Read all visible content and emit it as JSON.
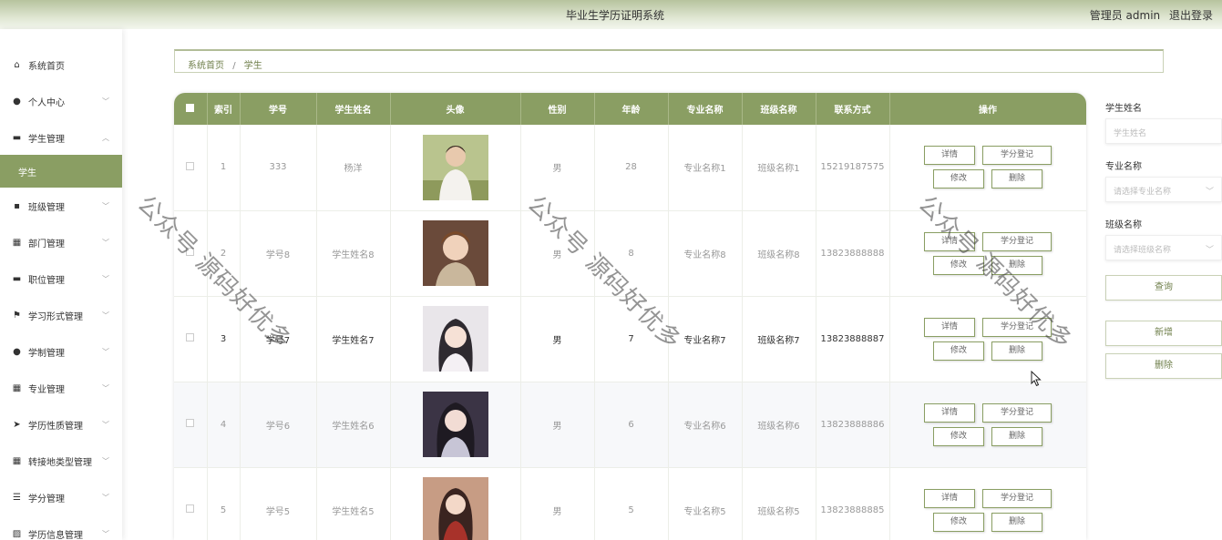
{
  "header": {
    "title": "毕业生学历证明系统",
    "user": "管理员 admin",
    "logout": "退出登录"
  },
  "sidebar": {
    "items": [
      {
        "label": "系统首页",
        "icon": "home-icon",
        "glyph": "⌂"
      },
      {
        "label": "个人中心",
        "icon": "user-icon",
        "glyph": "●"
      },
      {
        "label": "学生管理",
        "icon": "monitor-icon",
        "glyph": "▬"
      },
      {
        "label": "学生",
        "icon": "",
        "glyph": ""
      },
      {
        "label": "班级管理",
        "icon": "chat-icon",
        "glyph": "▪"
      },
      {
        "label": "部门管理",
        "icon": "grid-icon",
        "glyph": "▦"
      },
      {
        "label": "职位管理",
        "icon": "monitor-icon",
        "glyph": "▬"
      },
      {
        "label": "学习形式管理",
        "icon": "flag-icon",
        "glyph": "⚑"
      },
      {
        "label": "学制管理",
        "icon": "user-icon",
        "glyph": "●"
      },
      {
        "label": "专业管理",
        "icon": "grid-icon",
        "glyph": "▦"
      },
      {
        "label": "学历性质管理",
        "icon": "send-icon",
        "glyph": "➤"
      },
      {
        "label": "转接地类型管理",
        "icon": "grid-icon",
        "glyph": "▦"
      },
      {
        "label": "学分管理",
        "icon": "list-icon",
        "glyph": "☰"
      },
      {
        "label": "学历信息管理",
        "icon": "chart-icon",
        "glyph": "▨"
      }
    ]
  },
  "breadcrumb": {
    "home": "系统首页",
    "sep": "/",
    "current": "学生"
  },
  "table": {
    "headers": [
      "索引",
      "学号",
      "学生姓名",
      "头像",
      "性别",
      "年龄",
      "专业名称",
      "班级名称",
      "联系方式",
      "操作"
    ],
    "rows": [
      {
        "index": "1",
        "id": "333",
        "name": "杨洋",
        "gender": "男",
        "age": "28",
        "major": "专业名称1",
        "class": "班级名称1",
        "phone": "15219187575"
      },
      {
        "index": "2",
        "id": "学号8",
        "name": "学生姓名8",
        "gender": "男",
        "age": "8",
        "major": "专业名称8",
        "class": "班级名称8",
        "phone": "13823888888"
      },
      {
        "index": "3",
        "id": "学号7",
        "name": "学生姓名7",
        "gender": "男",
        "age": "7",
        "major": "专业名称7",
        "class": "班级名称7",
        "phone": "13823888887"
      },
      {
        "index": "4",
        "id": "学号6",
        "name": "学生姓名6",
        "gender": "男",
        "age": "6",
        "major": "专业名称6",
        "class": "班级名称6",
        "phone": "13823888886"
      },
      {
        "index": "5",
        "id": "学号5",
        "name": "学生姓名5",
        "gender": "男",
        "age": "5",
        "major": "专业名称5",
        "class": "班级名称5",
        "phone": "13823888885"
      }
    ],
    "actions": {
      "detail": "详情",
      "credit": "学分登记",
      "edit": "修改",
      "delete": "删除"
    }
  },
  "filter": {
    "name_label": "学生姓名",
    "name_placeholder": "学生姓名",
    "major_label": "专业名称",
    "major_placeholder": "请选择专业名称",
    "class_label": "班级名称",
    "class_placeholder": "请选择班级名称",
    "search": "查询",
    "add": "新增",
    "delete": "删除"
  },
  "watermark": "公众号 源码好优多",
  "colors": {
    "accent": "#8a9e63"
  }
}
